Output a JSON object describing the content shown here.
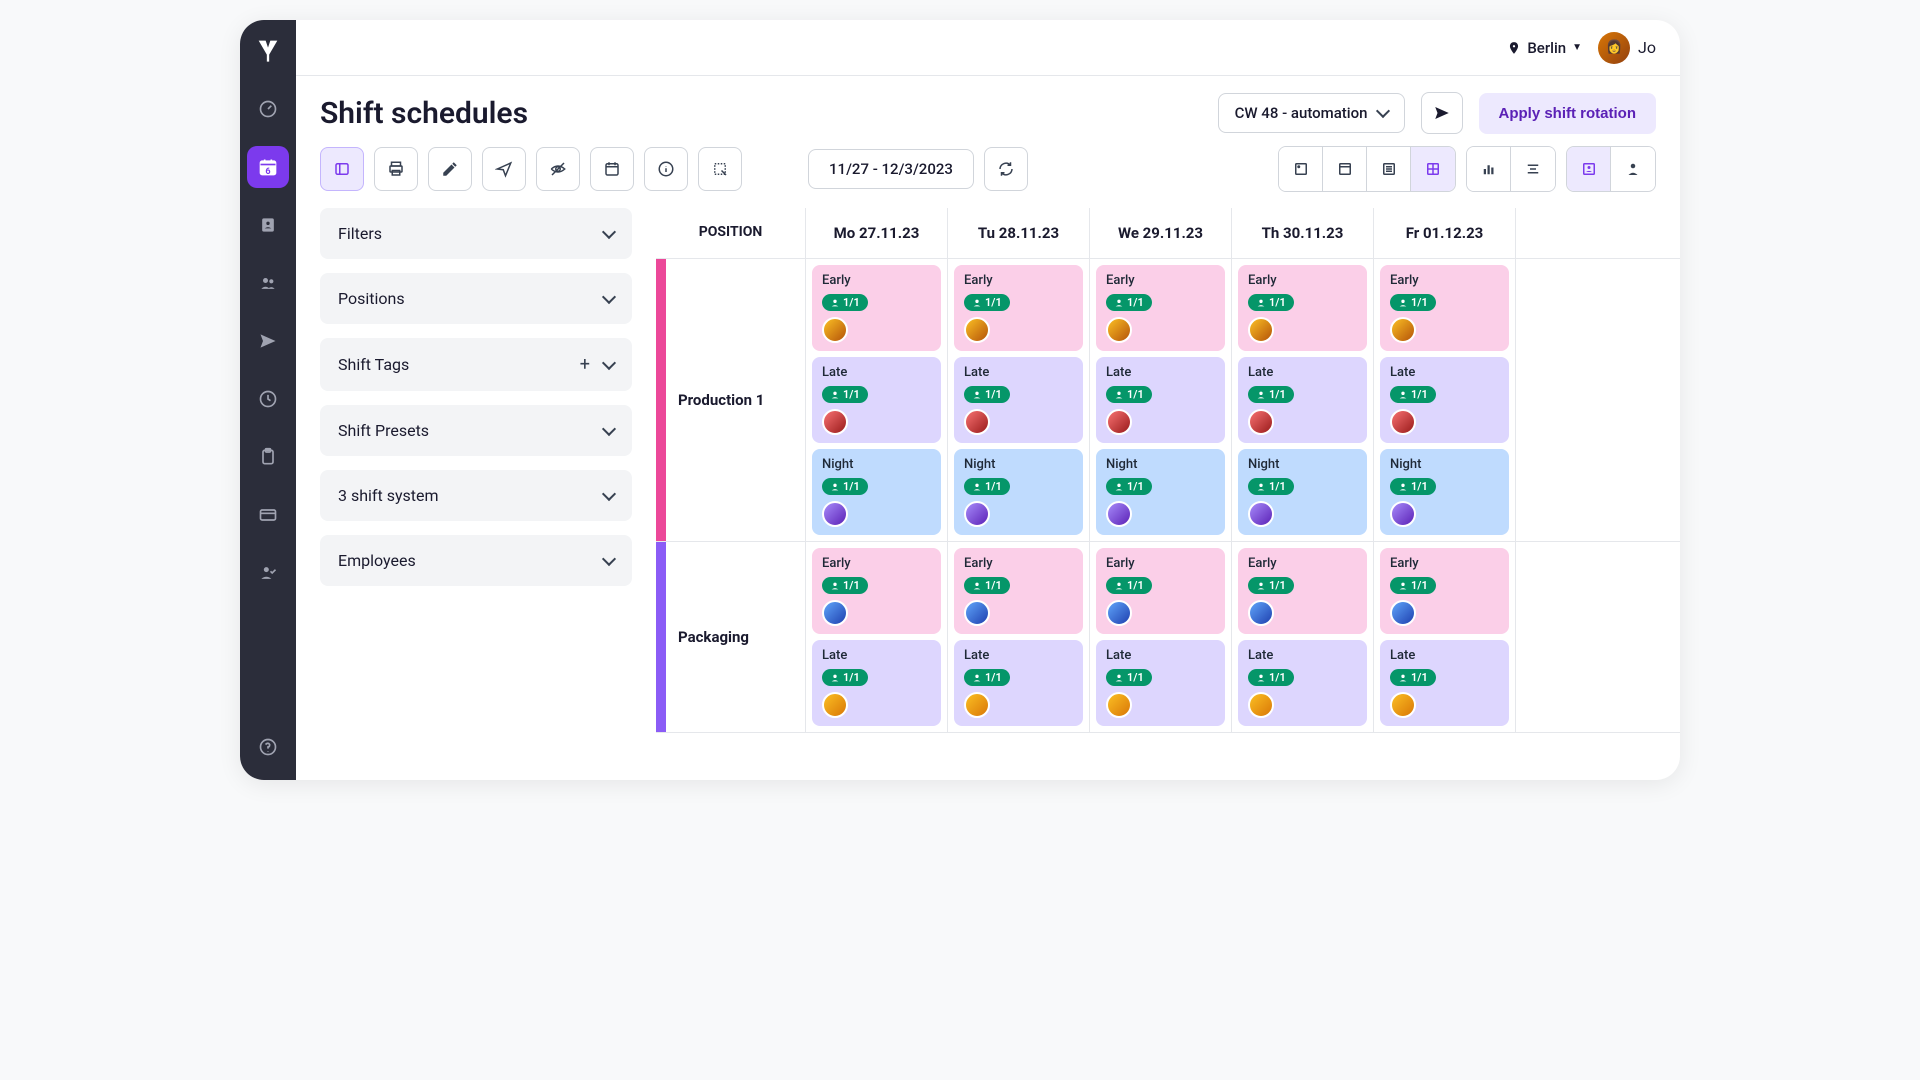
{
  "topbar": {
    "location": "Berlin",
    "user_short": "Jo"
  },
  "header": {
    "title": "Shift schedules",
    "week_selector": "CW 48 - automation",
    "apply_rotation": "Apply shift rotation",
    "date_range": "11/27 - 12/3/2023"
  },
  "nav": {
    "calendar_badge": "6"
  },
  "filters": [
    {
      "label": "Filters",
      "add": false
    },
    {
      "label": "Positions",
      "add": false
    },
    {
      "label": "Shift Tags",
      "add": true
    },
    {
      "label": "Shift Presets",
      "add": false
    },
    {
      "label": "3 shift system",
      "add": false
    },
    {
      "label": "Employees",
      "add": false
    }
  ],
  "schedule": {
    "position_header": "POSITION",
    "days": [
      "Mo 27.11.23",
      "Tu 28.11.23",
      "We 29.11.23",
      "Th 30.11.23",
      "Fr 01.12.23"
    ],
    "rows": [
      {
        "name": "Production 1",
        "color": "#ec4899",
        "shifts": [
          {
            "name": "Early",
            "badge": "1/1",
            "cls": "shift-early",
            "av": "av-a"
          },
          {
            "name": "Late",
            "badge": "1/1",
            "cls": "shift-late",
            "av": "av-b"
          },
          {
            "name": "Night",
            "badge": "1/1",
            "cls": "shift-night",
            "av": "av-c"
          }
        ]
      },
      {
        "name": "Packaging",
        "color": "#8b5cf6",
        "shifts": [
          {
            "name": "Early",
            "badge": "1/1",
            "cls": "shift-early",
            "av": "av-d"
          },
          {
            "name": "Late",
            "badge": "1/1",
            "cls": "shift-late",
            "av": "av-e"
          }
        ]
      }
    ]
  }
}
